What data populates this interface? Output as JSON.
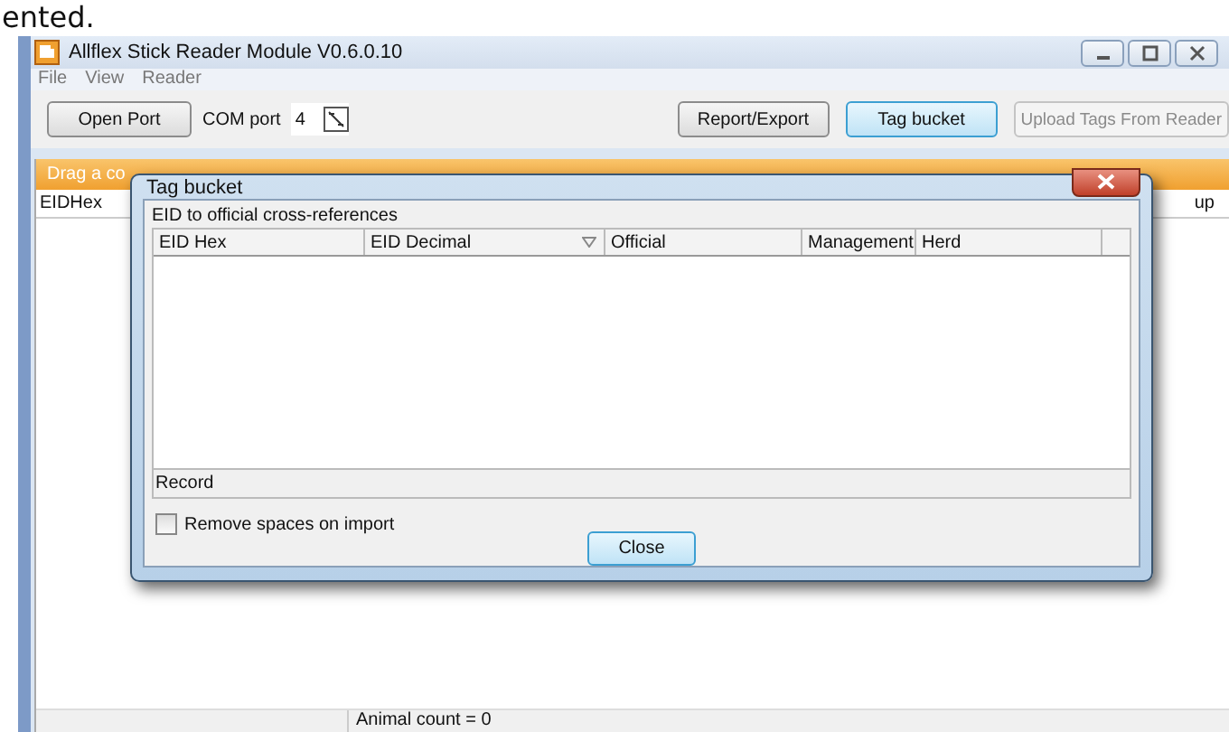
{
  "page_fragment": "ented.",
  "window": {
    "title": "Allflex Stick Reader Module V0.6.0.10"
  },
  "menu": [
    "File",
    "View",
    "Reader"
  ],
  "toolbar": {
    "open_port": "Open Port",
    "com_label": "COM port",
    "com_value": "4",
    "buttons": [
      {
        "label": "Report/Export",
        "selected": false,
        "disabled": false
      },
      {
        "label": "Tag bucket",
        "selected": true,
        "disabled": false
      },
      {
        "label": "Upload Tags From Reader",
        "selected": false,
        "disabled": true
      }
    ]
  },
  "group_bar": {
    "text": "Drag a co"
  },
  "columns": [
    {
      "label": "EIDHex"
    },
    {
      "label": "up"
    }
  ],
  "dialog": {
    "title": "Tag bucket",
    "group_label": "EID to official cross-references",
    "columns": [
      {
        "label": "EID Hex",
        "sorted": false
      },
      {
        "label": "EID Decimal",
        "sorted": true
      },
      {
        "label": "Official",
        "sorted": false
      },
      {
        "label": "Management",
        "sorted": false
      },
      {
        "label": "Herd",
        "sorted": false
      }
    ],
    "footer": "Record",
    "checkbox": {
      "label": "Remove spaces on import",
      "checked": false
    },
    "button": "Close"
  },
  "status_bar": {
    "text": "Animal count = 0"
  }
}
